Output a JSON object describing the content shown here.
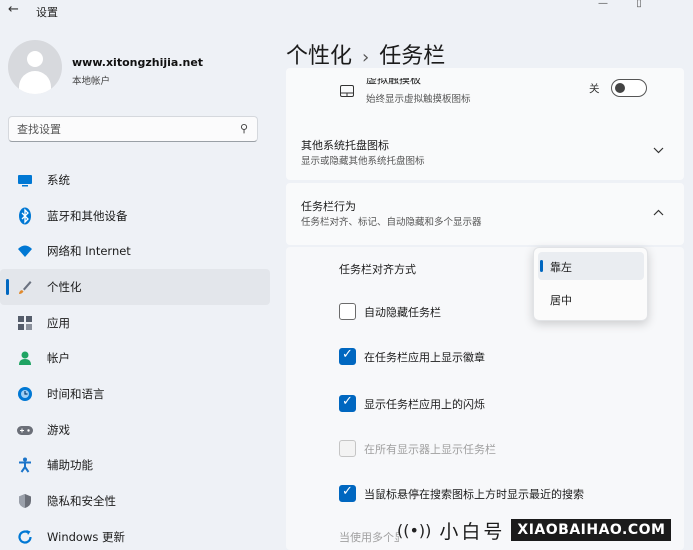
{
  "window": {
    "back_glyph": "←",
    "title": "设置",
    "controls": [
      "—",
      "▯",
      ""
    ]
  },
  "profile": {
    "name": "www.xitongzhijia.net",
    "account_type": "本地帐户"
  },
  "search": {
    "placeholder": "查找设置",
    "icon": "search-icon"
  },
  "nav": {
    "items": [
      {
        "label": "系统",
        "icon": "monitor-icon",
        "color": "#0078d4"
      },
      {
        "label": "蓝牙和其他设备",
        "icon": "bluetooth-icon",
        "color": "#0078d4"
      },
      {
        "label": "网络和 Internet",
        "icon": "wifi-icon",
        "color": "#0078d4"
      },
      {
        "label": "个性化",
        "icon": "brush-icon",
        "color": "#c47a2c",
        "active": true
      },
      {
        "label": "应用",
        "icon": "apps-icon",
        "color": "#555d6b"
      },
      {
        "label": "帐户",
        "icon": "person-icon",
        "color": "#1ea362"
      },
      {
        "label": "时间和语言",
        "icon": "globe-clock-icon",
        "color": "#0078d4"
      },
      {
        "label": "游戏",
        "icon": "gamepad-icon",
        "color": "#6b6f78"
      },
      {
        "label": "辅助功能",
        "icon": "accessibility-icon",
        "color": "#1b74c9"
      },
      {
        "label": "隐私和安全性",
        "icon": "shield-icon",
        "color": "#6b6f78"
      },
      {
        "label": "Windows 更新",
        "icon": "update-icon",
        "color": "#0078d4"
      }
    ]
  },
  "breadcrumb": {
    "parent": "个性化",
    "separator": "›",
    "current": "任务栏"
  },
  "touchpad": {
    "title": "虚拟触摸板",
    "subtitle": "始终显示虚拟触摸板图标",
    "state_label": "关"
  },
  "tray_icons": {
    "title": "其他系统托盘图标",
    "subtitle": "显示或隐藏其他系统托盘图标"
  },
  "behaviors": {
    "title": "任务栏行为",
    "subtitle": "任务栏对齐、标记、自动隐藏和多个显示器",
    "alignment_label": "任务栏对齐方式",
    "alignment_options": [
      "靠左",
      "居中"
    ],
    "alignment_selected": "靠左",
    "checkboxes": [
      {
        "label": "自动隐藏任务栏",
        "state": "unchecked"
      },
      {
        "label": "在任务栏应用上显示徽章",
        "state": "checked"
      },
      {
        "label": "显示任务栏应用上的闪烁",
        "state": "checked"
      },
      {
        "label": "在所有显示器上显示任务栏",
        "state": "disabled"
      },
      {
        "label": "当鼠标悬停在搜索图标上方时显示最近的搜索",
        "state": "checked"
      }
    ],
    "partial_text": "当使用多个显示器时，将我的任务栏应用显示于"
  },
  "watermark": {
    "cn": "小白号",
    "en": "XIAOBAIHAO.COM"
  },
  "accent_color": "#0067c0"
}
